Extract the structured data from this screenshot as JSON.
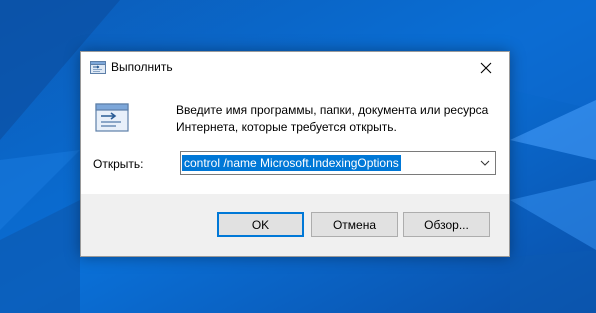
{
  "dialog": {
    "title": "Выполнить",
    "description_line1": "Введите имя программы, папки, документа или ресурса",
    "description_line2": "Интернета, которые требуется открыть.",
    "open_label": "Открыть:",
    "open_value": "control /name Microsoft.IndexingOptions",
    "ok_label": "OK",
    "cancel_label": "Отмена",
    "browse_label": "Обзор...",
    "icons": {
      "title": "run-icon",
      "main": "run-icon",
      "close": "close-icon",
      "dropdown": "chevron-down-icon"
    }
  },
  "colors": {
    "desktop": "#0a64c4",
    "accent": "#0078d7",
    "footer": "#f0f0f0",
    "button": "#e1e1e1"
  }
}
